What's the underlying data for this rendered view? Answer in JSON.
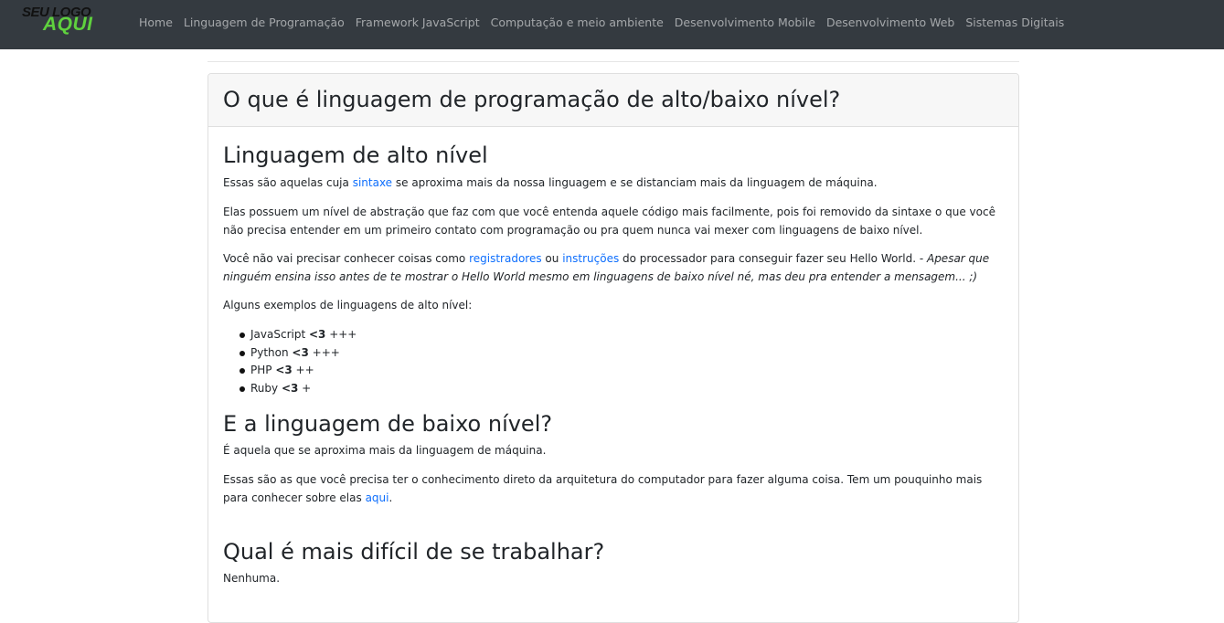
{
  "logo": {
    "line1": "SEU LOGO",
    "line2": "AQUI"
  },
  "nav": {
    "items": [
      "Home",
      "Linguagem de Programação",
      "Framework JavaScript",
      "Computação e meio ambiente",
      "Desenvolvimento Mobile",
      "Desenvolvimento Web",
      "Sistemas Digitais"
    ]
  },
  "card": {
    "title": "O que é linguagem de programação de alto/baixo nível?",
    "s1": {
      "heading": "Linguagem de alto nível",
      "p1_a": "Essas são aquelas cuja ",
      "p1_link": "sintaxe",
      "p1_b": " se aproxima mais da nossa linguagem e se distanciam mais da linguagem de máquina.",
      "p2": "Elas possuem um nível de abstração que faz com que você entenda aquele código mais facilmente, pois foi removido da sintaxe o que você não precisa entender em um primeiro contato com programação ou pra quem nunca vai mexer com linguagens de baixo nível.",
      "p3_a": "Você não vai precisar conhecer coisas como ",
      "p3_link1": "registradores",
      "p3_b": " ou ",
      "p3_link2": "instruções",
      "p3_c": " do processador para conseguir fazer seu Hello World. - ",
      "p3_em": "Apesar que ninguém ensina isso antes de te mostrar o Hello World mesmo em linguagens de baixo nível né, mas deu pra entender a mensagem... ;)",
      "p4": "Alguns exemplos de linguagens de alto nível:",
      "examples": [
        {
          "name": "JavaScript ",
          "heart": "<3",
          "rating": " +++"
        },
        {
          "name": "Python ",
          "heart": "<3",
          "rating": " +++"
        },
        {
          "name": "PHP ",
          "heart": "<3",
          "rating": " ++"
        },
        {
          "name": "Ruby ",
          "heart": "<3",
          "rating": " +"
        }
      ]
    },
    "s2": {
      "heading": "E a linguagem de baixo nível?",
      "p1": "É aquela que se aproxima mais da linguagem de máquina.",
      "p2_a": "Essas são as que você precisa ter o conhecimento direto da arquitetura do computador para fazer alguma coisa. Tem um pouquinho mais para conhecer sobre elas ",
      "p2_link": "aqui",
      "p2_b": "."
    },
    "s3": {
      "heading": "Qual é mais difícil de se trabalhar?",
      "p1": "Nenhuma."
    }
  }
}
